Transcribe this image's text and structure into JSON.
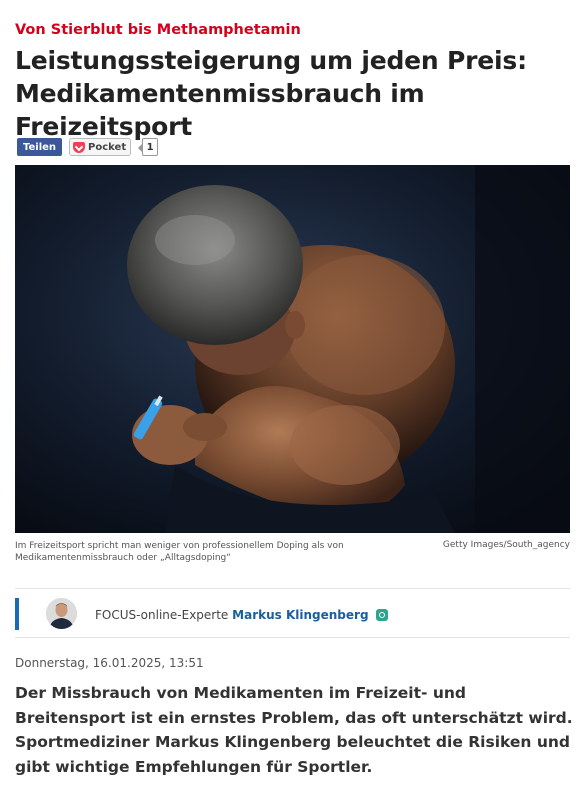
{
  "article": {
    "kicker": "Von Stierblut bis Methamphetamin",
    "headline": "Leistungssteigerung um jeden Preis: Medikamentenmissbrauch im Freizeitsport"
  },
  "social": {
    "share_label": "Teilen",
    "pocket_label": "Pocket",
    "count": "1"
  },
  "image": {
    "caption": "Im Freizeitsport spricht man weniger von professionellem Doping als von Medikamentenmissbrauch oder „Alltagsdoping“",
    "credit": "Getty Images/South_agency"
  },
  "author": {
    "prefix": "FOCUS-online-Experte",
    "name": "Markus Klingenberg"
  },
  "meta": {
    "date": "Donnerstag, 16.01.2025, 13:51"
  },
  "lead": "Der Missbrauch von Medikamenten im Freizeit- und Breitensport ist ein ernstes Problem, das oft unterschätzt wird. Sportmediziner Markus Klingenberg beleuchtet die Risiken und gibt wichtige Empfehlungen für Sportler.",
  "colors": {
    "kicker": "#d6001c",
    "share_button": "#3b5998",
    "pocket": "#ef4056",
    "author_accent": "#1a6bb5",
    "author_link": "#1a5ea0"
  }
}
